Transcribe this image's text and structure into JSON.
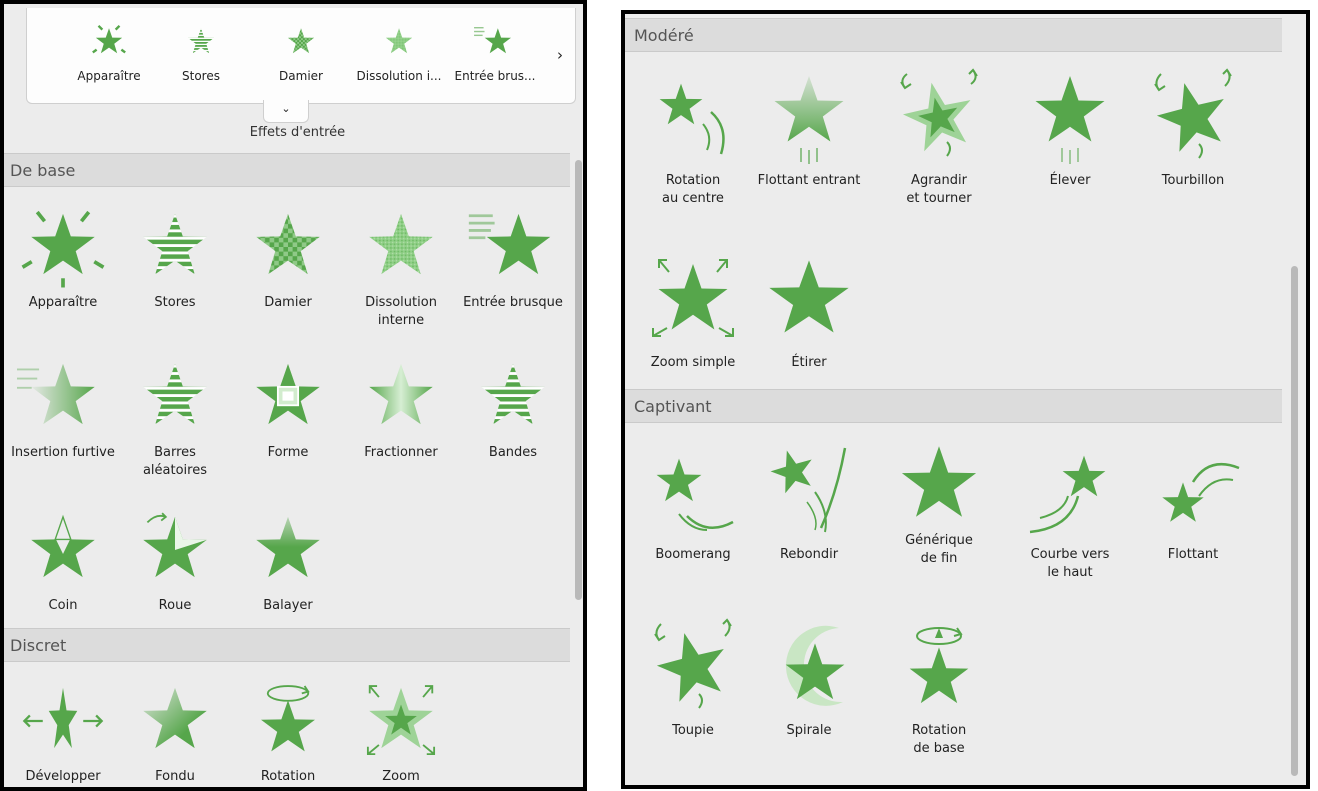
{
  "colors": {
    "star": "#56a64b",
    "star_light": "#9ed397"
  },
  "ribbon": {
    "items": [
      {
        "label": "Apparaître",
        "icon": "star-burst"
      },
      {
        "label": "Stores",
        "icon": "star-stripes"
      },
      {
        "label": "Damier",
        "icon": "star-checker"
      },
      {
        "label": "Dissolution i...",
        "icon": "star-dissolve"
      },
      {
        "label": "Entrée brus...",
        "icon": "star-lines"
      }
    ],
    "next_glyph": "›",
    "expand_glyph": "⌄",
    "caption": "Effets d'entrée"
  },
  "left": {
    "sections": {
      "de_base": "De base",
      "discret": "Discret"
    },
    "effects": [
      {
        "label": "Apparaître",
        "icon": "star-burst"
      },
      {
        "label": "Stores",
        "icon": "star-stripes"
      },
      {
        "label": "Damier",
        "icon": "star-checker"
      },
      {
        "label": "Dissolution\ninterne",
        "icon": "star-dissolve"
      },
      {
        "label": "Entrée brusque",
        "icon": "star-lines"
      },
      {
        "label": "Insertion furtive",
        "icon": "star-fade-left"
      },
      {
        "label": "Barres\naléatoires",
        "icon": "star-stripes"
      },
      {
        "label": "Forme",
        "icon": "star-box"
      },
      {
        "label": "Fractionner",
        "icon": "star-split"
      },
      {
        "label": "Bandes",
        "icon": "star-stripes"
      },
      {
        "label": "Coin",
        "icon": "star-corner"
      },
      {
        "label": "Roue",
        "icon": "star-wheel"
      },
      {
        "label": "Balayer",
        "icon": "star-wipe"
      },
      {
        "label": "Développer",
        "icon": "star-expand"
      },
      {
        "label": "Fondu",
        "icon": "star-fade"
      },
      {
        "label": "Rotation",
        "icon": "star-rotate"
      },
      {
        "label": "Zoom",
        "icon": "star-zoom"
      }
    ]
  },
  "right": {
    "sections": {
      "modere": "Modéré",
      "captivant": "Captivant"
    },
    "effects": [
      {
        "label": "Rotation\nau centre",
        "icon": "star-swing"
      },
      {
        "label": "Flottant entrant",
        "icon": "star-float-in"
      },
      {
        "label": "Agrandir\net tourner",
        "icon": "star-grow-turn"
      },
      {
        "label": "Élever",
        "icon": "star-rise"
      },
      {
        "label": "Tourbillon",
        "icon": "star-spin"
      },
      {
        "label": "Zoom simple",
        "icon": "star-zoom"
      },
      {
        "label": "Étirer",
        "icon": "star-plain"
      },
      {
        "label": "Boomerang",
        "icon": "star-boomerang"
      },
      {
        "label": "Rebondir",
        "icon": "star-bounce"
      },
      {
        "label": "Générique\nde fin",
        "icon": "star-plain"
      },
      {
        "label": "Courbe vers\nle haut",
        "icon": "star-curve-up"
      },
      {
        "label": "Flottant",
        "icon": "star-float"
      },
      {
        "label": "Toupie",
        "icon": "star-spin"
      },
      {
        "label": "Spirale",
        "icon": "star-spiral"
      },
      {
        "label": "Rotation\nde base",
        "icon": "star-rotate"
      }
    ]
  }
}
